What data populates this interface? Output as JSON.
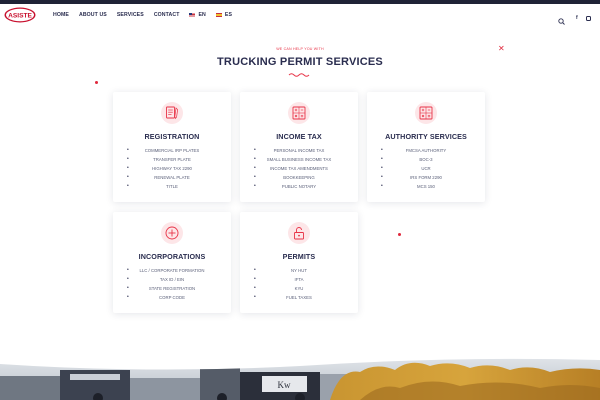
{
  "header": {
    "logo_text": "ASISTE",
    "nav": [
      {
        "label": "HOME"
      },
      {
        "label": "ABOUT US"
      },
      {
        "label": "SERVICES"
      },
      {
        "label": "CONTACT"
      }
    ],
    "lang_en": "EN",
    "lang_es": "ES",
    "social_fb": "f"
  },
  "section": {
    "eyebrow": "WE CAN HELP YOU WITH",
    "title": "TRUCKING PERMIT SERVICES"
  },
  "cards": [
    {
      "title": "REGISTRATION",
      "icon": "document-pen-icon",
      "items": [
        "COMMERCIAL IRP PLATES",
        "TRANSFER PLATE",
        "HIGHWAY TAX 2290",
        "RENEWAL PLATE",
        "TITLE"
      ]
    },
    {
      "title": "INCOME TAX",
      "icon": "calculator-icon",
      "items": [
        "PERSONAL INCOME TAX",
        "SMALL BUSINESS INCOME TAX",
        "INCOME TAX AMENDMENTS",
        "BOOKKEEPING",
        "PUBLIC NOTARY"
      ]
    },
    {
      "title": "AUTHORITY SERVICES",
      "icon": "calculator-icon",
      "items": [
        "FMCSA AUTHORITY",
        "BOC-3",
        "UCR",
        "IRS FORM 2290",
        "MCS 150"
      ]
    },
    {
      "title": "INCORPORATIONS",
      "icon": "plus-circle-icon",
      "items": [
        "LLC / CORPORATE FORMATION",
        "TAX ID / EIN",
        "STATE REGISTRATION",
        "CORP CODE"
      ]
    },
    {
      "title": "PERMITS",
      "icon": "unlock-icon",
      "items": [
        "NY HUT",
        "IFTA",
        "KYU",
        "FUEL TAXES"
      ]
    }
  ],
  "colors": {
    "accent": "#e83347",
    "navy": "#2a2d4f",
    "icon_bg": "#fde6e8"
  }
}
